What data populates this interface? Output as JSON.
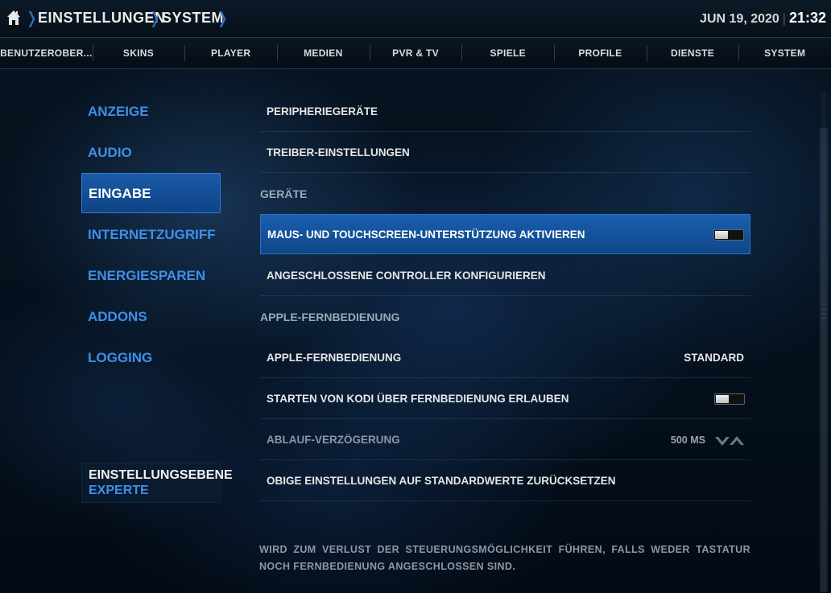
{
  "breadcrumb": {
    "items": [
      "EINSTELLUNGEN",
      "SYSTEM"
    ]
  },
  "clock": {
    "date": "JUN 19, 2020",
    "time": "21:32"
  },
  "tabs": [
    {
      "label": "BENUTZEROBER..."
    },
    {
      "label": "SKINS"
    },
    {
      "label": "PLAYER"
    },
    {
      "label": "MEDIEN"
    },
    {
      "label": "PVR & TV"
    },
    {
      "label": "SPIELE"
    },
    {
      "label": "PROFILE"
    },
    {
      "label": "DIENSTE"
    },
    {
      "label": "SYSTEM"
    }
  ],
  "sidebar": {
    "items": [
      {
        "label": "ANZEIGE"
      },
      {
        "label": "AUDIO"
      },
      {
        "label": "EINGABE",
        "active": true
      },
      {
        "label": "INTERNETZUGRIFF"
      },
      {
        "label": "ENERGIESPAREN"
      },
      {
        "label": "ADDONS"
      },
      {
        "label": "LOGGING"
      }
    ],
    "level_label": "EINSTELLUNGSEBENE",
    "level_value": "EXPERTE"
  },
  "settings": {
    "rows": [
      {
        "label": "PERIPHERIEGERÄTE"
      },
      {
        "label": "TREIBER-EINSTELLUNGEN"
      },
      {
        "label": "GERÄTE"
      },
      {
        "label": "MAUS- UND TOUCHSCREEN-UNTERSTÜTZUNG AKTIVIEREN",
        "toggle": "off"
      },
      {
        "label": "ANGESCHLOSSENE CONTROLLER KONFIGURIEREN"
      },
      {
        "label": "APPLE-FERNBEDIENUNG"
      },
      {
        "label": "APPLE-FERNBEDIENUNG",
        "value": "STANDARD"
      },
      {
        "label": "STARTEN VON KODI ÜBER FERNBEDIENUNG ERLAUBEN",
        "toggle": "off"
      },
      {
        "label": "ABLAUF-VERZÖGERUNG",
        "value": "500 MS"
      },
      {
        "label": "OBIGE EINSTELLUNGEN AUF STANDARDWERTE ZURÜCKSETZEN"
      }
    ]
  },
  "description": "WIRD ZUM VERLUST DER STEUERUNGSMÖGLICHKEIT FÜHREN, FALLS WEDER TASTATUR NOCH FERNBEDIENUNG ANGESCHLOSSEN SIND.",
  "colors": {
    "accent": "#1a5fb0",
    "sidebar_text": "#3f8fe8",
    "background": "#04101c"
  }
}
